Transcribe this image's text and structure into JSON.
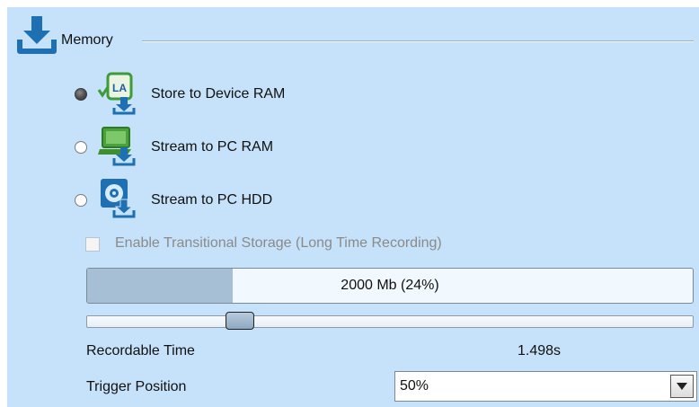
{
  "section": {
    "title": "Memory",
    "icon": "download-icon"
  },
  "options": [
    {
      "label": "Store to Device RAM",
      "selected": true,
      "icon": "device-ram-download-icon",
      "badge": "LA"
    },
    {
      "label": "Stream to PC RAM",
      "selected": false,
      "icon": "pc-ram-download-icon"
    },
    {
      "label": "Stream to PC HDD",
      "selected": false,
      "icon": "pc-hdd-download-icon"
    }
  ],
  "transitional_storage": {
    "label": "Enable Transitional Storage (Long Time Recording)",
    "checked": false,
    "enabled": false
  },
  "memory_bar": {
    "text": "2000 Mb (24%)",
    "fraction": 0.24
  },
  "memory_slider": {
    "fraction": 0.24
  },
  "recordable_time": {
    "label": "Recordable Time",
    "value": "1.498s"
  },
  "trigger_position": {
    "label": "Trigger Position",
    "value": "50%"
  },
  "colors": {
    "panel": "#c6e2fa",
    "accent": "#1f6fb3",
    "bar_fill": "#a6bfd4",
    "green": "#4aa33a"
  }
}
